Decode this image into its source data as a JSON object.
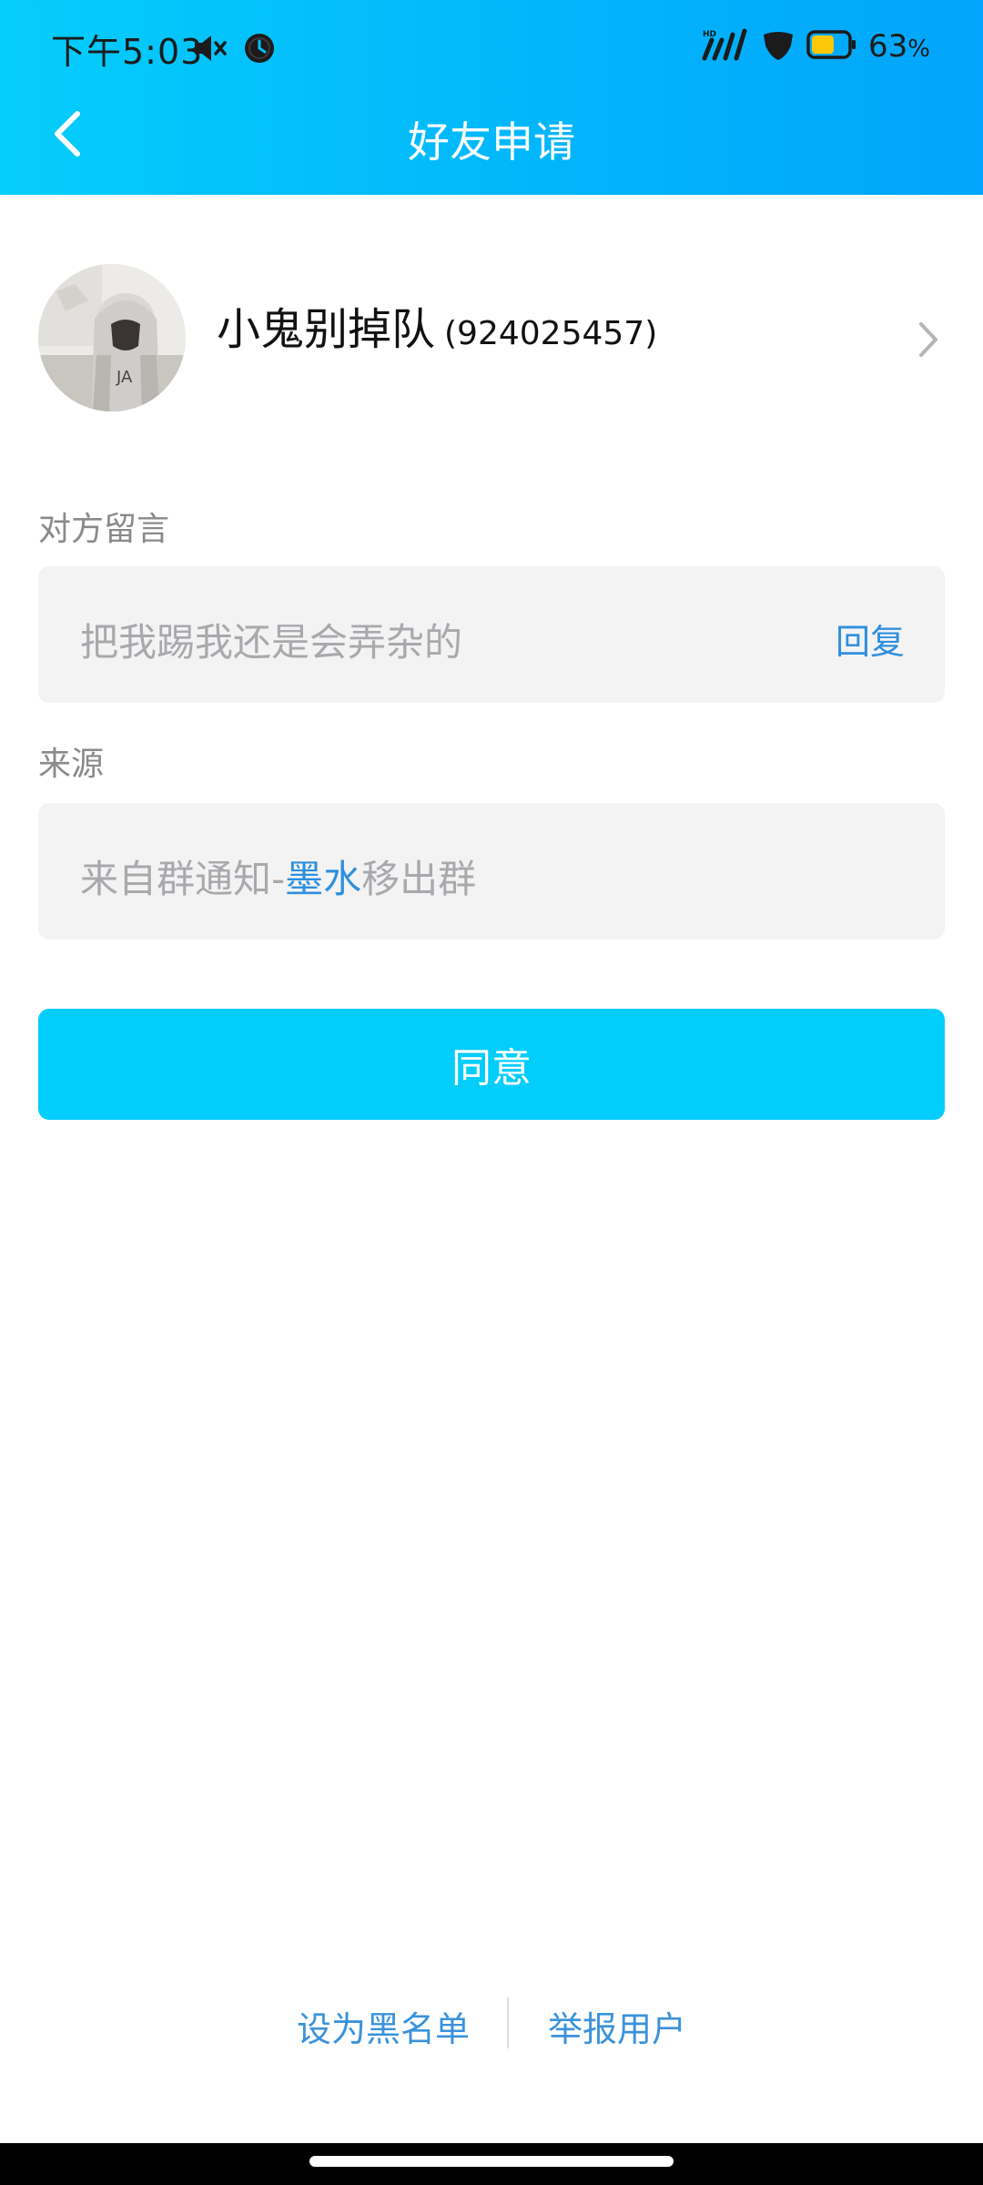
{
  "status_bar": {
    "time": "下午5:03",
    "battery_percent": "63",
    "battery_symbol": "%",
    "battery_level": 0.63,
    "icons": [
      "mute-icon",
      "alarm-icon",
      "hd-signal-icon",
      "vpn-shield-icon",
      "battery-icon"
    ]
  },
  "navbar": {
    "title": "好友申请"
  },
  "profile": {
    "name": "小鬼别掉队",
    "uin": "(924025457)"
  },
  "message": {
    "label": "对方留言",
    "text": "把我踢我还是会弄杂的",
    "reply_label": "回复"
  },
  "source": {
    "label": "来源",
    "prefix": "来自群通知-",
    "highlight": "墨水",
    "suffix": "移出群"
  },
  "actions": {
    "agree_label": "同意",
    "blacklist_label": "设为黑名单",
    "report_label": "举报用户"
  },
  "colors": {
    "header_gradient_start": "#05cdfb",
    "header_gradient_end": "#02a5fb",
    "primary_button": "#02cdfb",
    "link_blue": "#2f8fde"
  }
}
